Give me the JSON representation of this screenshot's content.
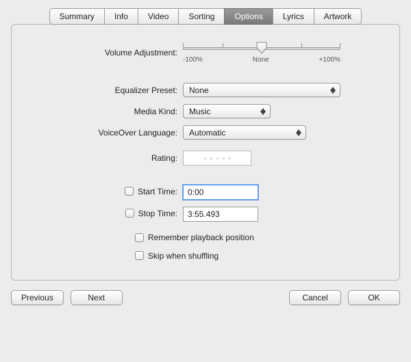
{
  "tabs": {
    "summary": "Summary",
    "info": "Info",
    "video": "Video",
    "sorting": "Sorting",
    "options": "Options",
    "lyrics": "Lyrics",
    "artwork": "Artwork"
  },
  "labels": {
    "volume_adjustment": "Volume Adjustment:",
    "equalizer_preset": "Equalizer Preset:",
    "media_kind": "Media Kind:",
    "voiceover_language": "VoiceOver Language:",
    "rating": "Rating:",
    "start_time": "Start Time:",
    "stop_time": "Stop Time:",
    "remember_playback": "Remember playback position",
    "skip_when_shuffling": "Skip when shuffling"
  },
  "volume": {
    "min_label": "-100%",
    "mid_label": "None",
    "max_label": "+100%",
    "value": 0
  },
  "fields": {
    "equalizer_preset": "None",
    "media_kind": "Music",
    "voiceover_language": "Automatic",
    "start_time": "0:00",
    "stop_time": "3:55.493"
  },
  "checkboxes": {
    "start_time": false,
    "stop_time": false,
    "remember_playback": false,
    "skip_when_shuffling": false
  },
  "buttons": {
    "previous": "Previous",
    "next": "Next",
    "cancel": "Cancel",
    "ok": "OK"
  }
}
